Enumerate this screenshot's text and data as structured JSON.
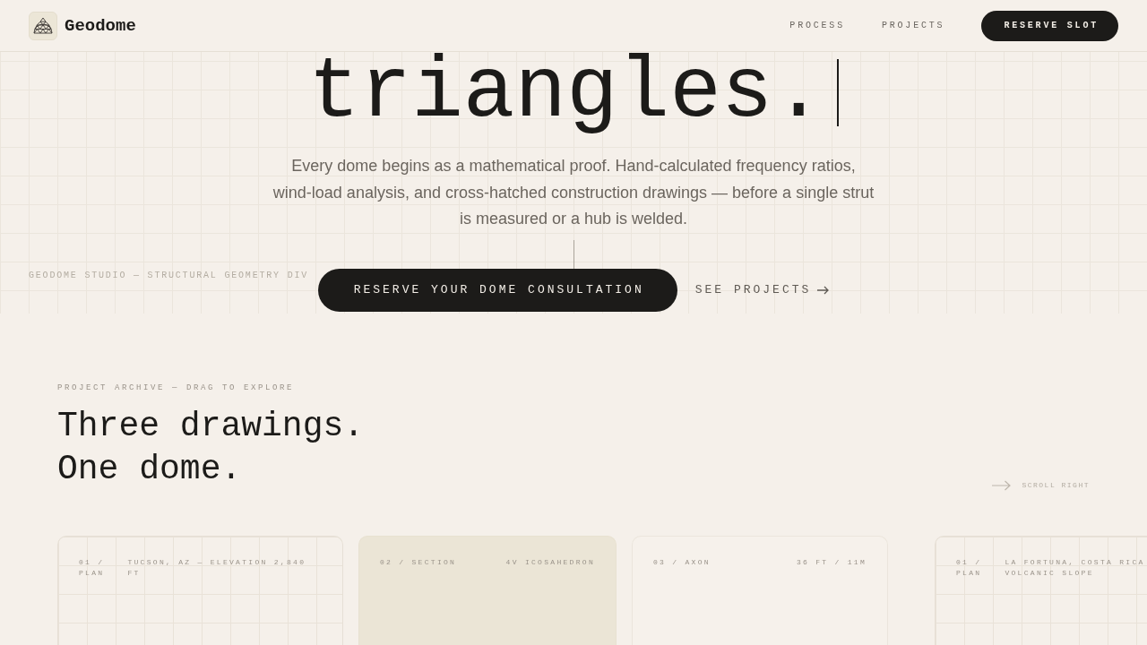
{
  "header": {
    "brand": "Geodome",
    "nav": [
      {
        "label": "PROCESS"
      },
      {
        "label": "PROJECTS"
      }
    ],
    "cta": "RESERVE SLOT"
  },
  "hero": {
    "title": "triangles.",
    "lead": "Every dome begins as a mathematical proof. Hand-calculated frequency ratios, wind-load analysis, and cross-hatched construction drawings — before a single strut is measured or a hub is welded.",
    "side_caption": "GEODOME STUDIO — STRUCTURAL GEOMETRY DIV",
    "primary_button": "RESERVE YOUR DOME CONSULTATION",
    "secondary_link": "SEE PROJECTS"
  },
  "archive": {
    "eyebrow": "PROJECT ARCHIVE — DRAG TO EXPLORE",
    "heading": "Three drawings. One dome.",
    "scroll_hint": "SCROLL RIGHT",
    "cards": [
      {
        "kind": "plan",
        "label": "01 / PLAN",
        "meta": "TUCSON, AZ — ELEVATION 2,840 FT"
      },
      {
        "kind": "section",
        "label": "02 / SECTION",
        "meta": "4V ICOSAHEDRON"
      },
      {
        "kind": "axon",
        "label": "03 / AXON",
        "meta": "36 FT / 11M"
      },
      {
        "kind": "plan",
        "label": "01 / PLAN",
        "meta": "LA FORTUNA, COSTA RICA VOLCANIC SLOPE"
      }
    ]
  }
}
